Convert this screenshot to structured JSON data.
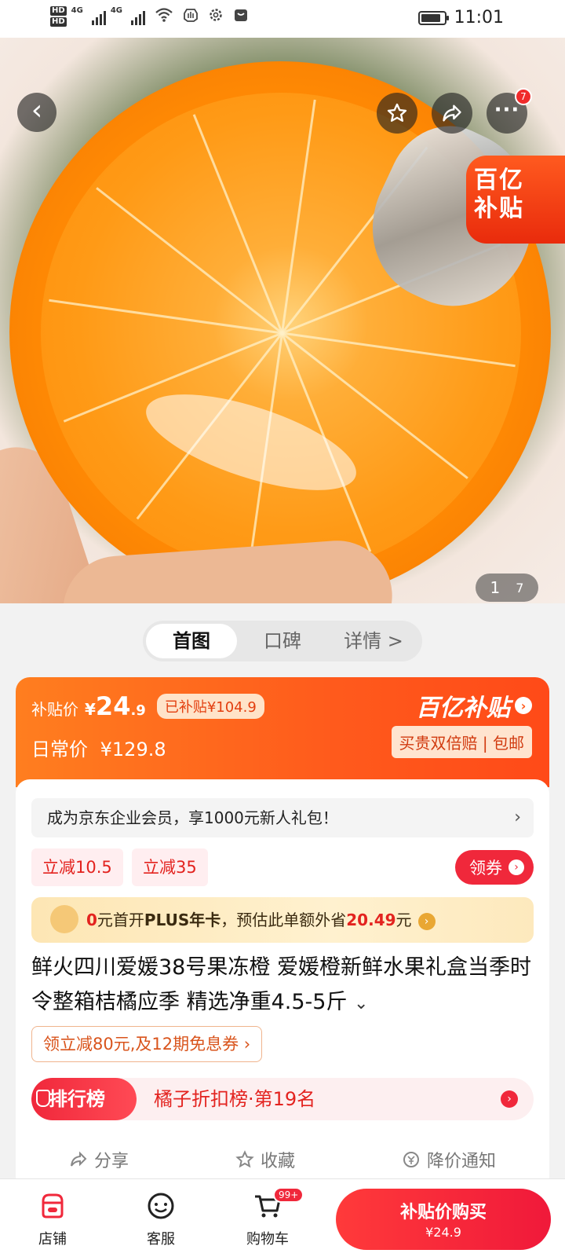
{
  "status_bar": {
    "hd_labels": [
      "HD",
      "HD"
    ],
    "network": [
      "4G",
      "4G"
    ],
    "time": "11:01",
    "battery_level": 0.85
  },
  "hero": {
    "image_index": "1",
    "image_total": "7",
    "more_badge": "7",
    "subsidy_tag_line1": "百亿",
    "subsidy_tag_line2": "补贴"
  },
  "tabs": [
    {
      "label": "首图",
      "active": true
    },
    {
      "label": "口碑",
      "active": false
    },
    {
      "label": "详情 >",
      "active": false
    }
  ],
  "price": {
    "subsidy_label": "补贴价",
    "currency": "¥",
    "subsidy_price_int": "24",
    "subsidy_price_dec": ".9",
    "subsidized_amount": "已补贴¥104.9",
    "daily_label": "日常价",
    "daily_price": "¥129.8",
    "brand": "百亿补贴",
    "guarantee": "买贵双倍赔 | 包邮"
  },
  "member_banner": {
    "text": "成为京东企业会员，享1000元新人礼包！",
    "chevron": "›"
  },
  "coupons": [
    "立减10.5",
    "立减35"
  ],
  "claim_button": "领券",
  "plus_banner": {
    "part1": "0",
    "part2": "元首开",
    "part3": "PLUS年卡",
    "part4": "，预估此单额外省",
    "saving": "20.49",
    "part5": "元"
  },
  "product": {
    "title": "鲜火四川爱媛38号果冻橙 爱媛橙新鲜水果礼盒当季时令整箱桔橘应季 精选净重4.5-5斤"
  },
  "promo_chip": "领立减80元,及12期免息券 ›",
  "rank": {
    "badge": "排行榜",
    "text": "橘子折扣榜·第19名"
  },
  "actions": [
    {
      "icon": "share-icon",
      "label": "分享"
    },
    {
      "icon": "star-icon",
      "label": "收藏"
    },
    {
      "icon": "price-drop-icon",
      "label": "降价通知"
    }
  ],
  "bottom_bar": {
    "shop": "店铺",
    "service": "客服",
    "cart": "购物车",
    "cart_badge": "99+",
    "buy_label": "补贴价购买",
    "buy_price": "¥24.9"
  },
  "colors": {
    "accent_red": "#f0283b",
    "subsidy_orange": "#ff5a1c",
    "plus_gold": "#fde6b4"
  }
}
